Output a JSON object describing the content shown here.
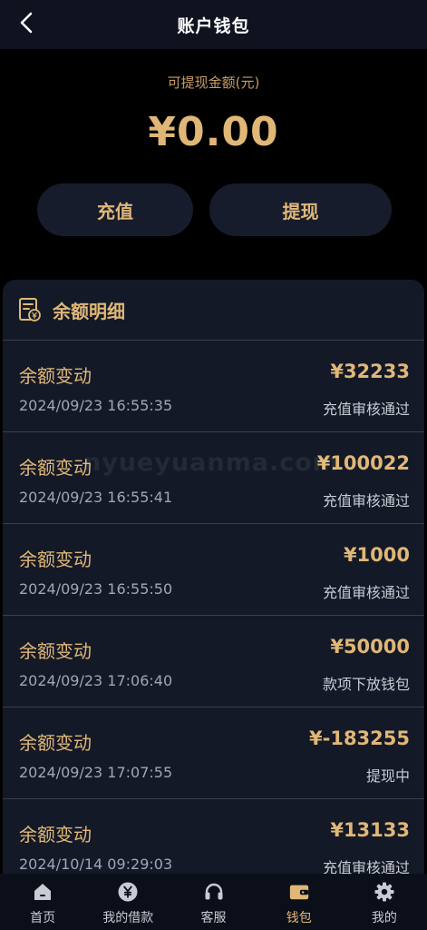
{
  "header": {
    "title": "账户钱包"
  },
  "balance": {
    "label": "可提现金额(元)",
    "amount": "¥0.00",
    "recharge_label": "充值",
    "withdraw_label": "提现"
  },
  "detail": {
    "title": "余额明细",
    "records": [
      {
        "title": "余额变动",
        "amount": "¥32233",
        "time": "2024/09/23 16:55:35",
        "status": "充值审核通过"
      },
      {
        "title": "余额变动",
        "amount": "¥100022",
        "time": "2024/09/23 16:55:41",
        "status": "充值审核通过"
      },
      {
        "title": "余额变动",
        "amount": "¥1000",
        "time": "2024/09/23 16:55:50",
        "status": "充值审核通过"
      },
      {
        "title": "余额变动",
        "amount": "¥50000",
        "time": "2024/09/23 17:06:40",
        "status": "款项下放钱包"
      },
      {
        "title": "余额变动",
        "amount": "¥-183255",
        "time": "2024/09/23 17:07:55",
        "status": "提现中"
      },
      {
        "title": "余额变动",
        "amount": "¥13133",
        "time": "2024/10/14 09:29:03",
        "status": "充值审核通过"
      }
    ]
  },
  "watermark": "nyueyuanma.com",
  "tabs": [
    {
      "label": "首页",
      "icon": "home-icon"
    },
    {
      "label": "我的借款",
      "icon": "yen-coin-icon"
    },
    {
      "label": "客服",
      "icon": "headset-icon"
    },
    {
      "label": "钱包",
      "icon": "wallet-icon",
      "active": true
    },
    {
      "label": "我的",
      "icon": "gear-icon"
    }
  ],
  "colors": {
    "accent": "#e0b777",
    "background": "#000000",
    "card": "#141927",
    "button": "#161c2b",
    "tabbar": "#0b0f19"
  }
}
